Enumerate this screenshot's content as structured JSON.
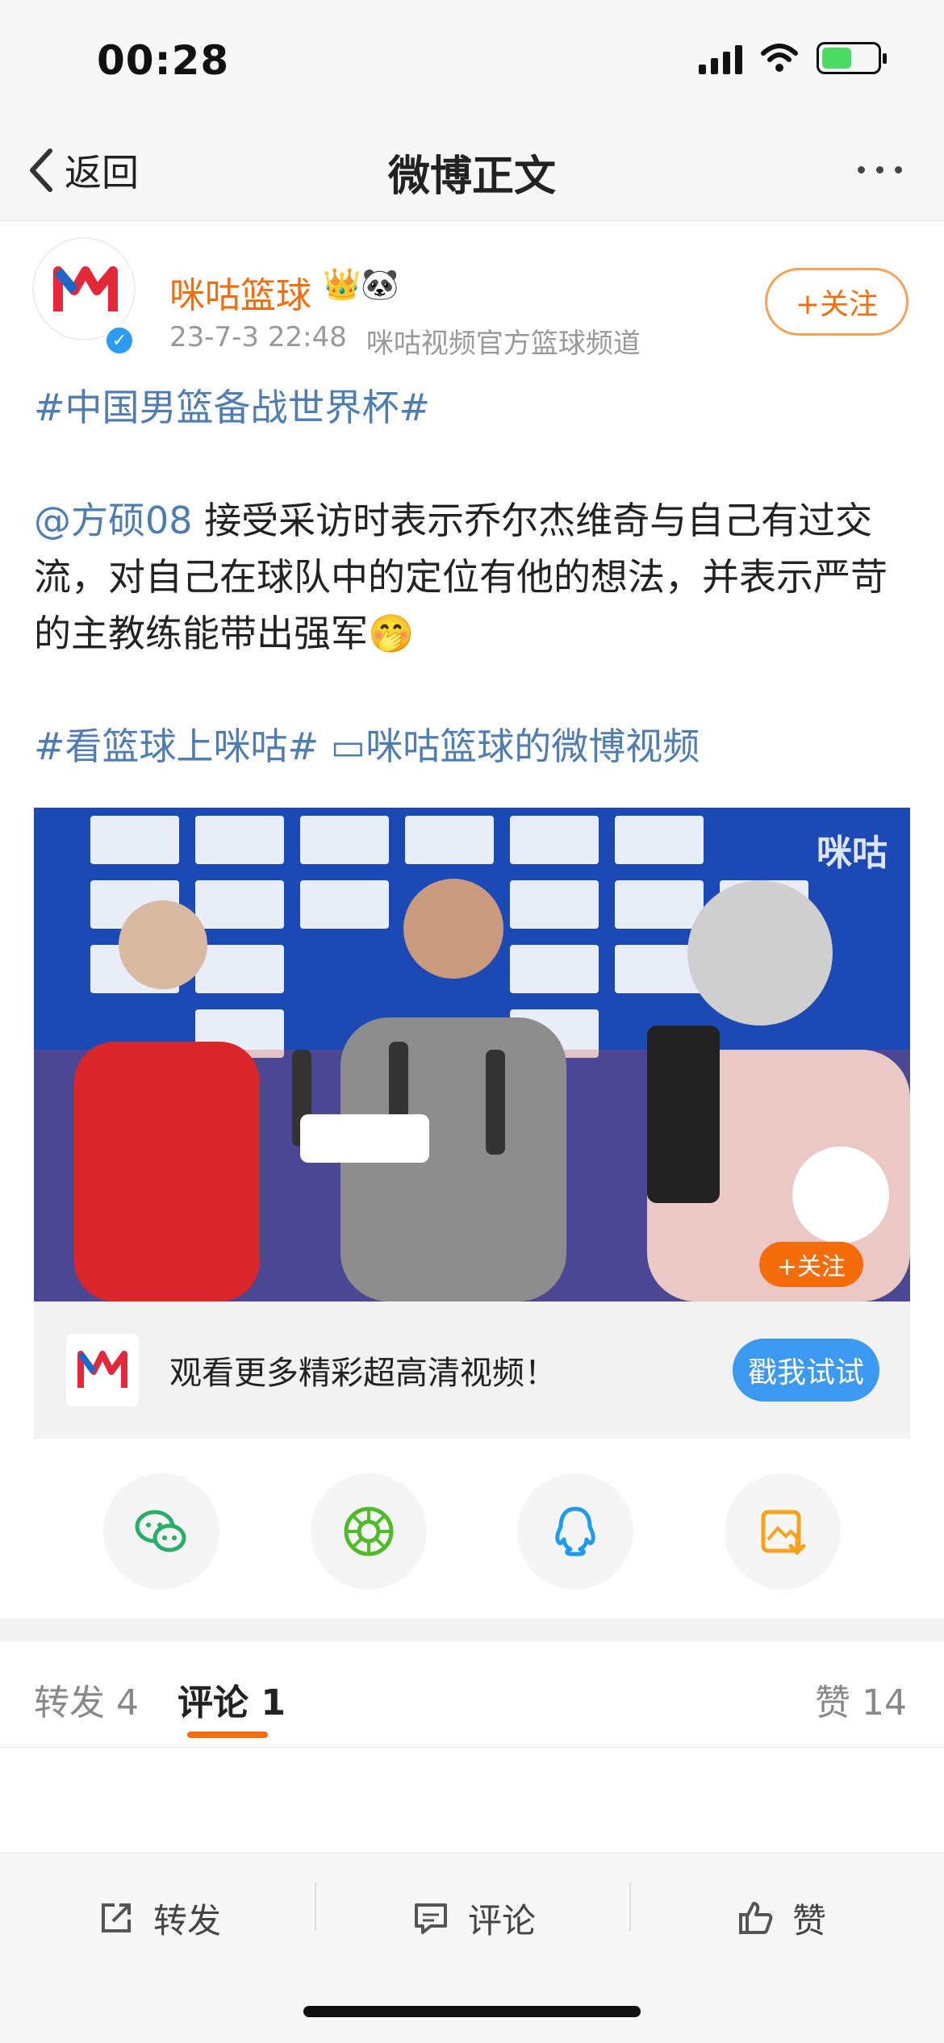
{
  "status_bar": {
    "time": "00:28"
  },
  "nav": {
    "back_label": "返回",
    "title": "微博正文"
  },
  "post": {
    "author": "咪咕篮球",
    "author_badges": "👑🐼",
    "date": "23-7-3 22:48",
    "source": "咪咕视频官方篮球频道",
    "follow_label": "+关注",
    "hashtag1": "#中国男篮备战世界杯#",
    "mention": "@方硕08",
    "text_body": " 接受采访时表示乔尔杰维奇与自己有过交流，对自己在球队中的定位有他的想法，并表示严苛的主教练能带出强军",
    "emoji": "🤭",
    "hashtag2": "#看篮球上咪咕#",
    "video_link": "咪咕篮球的微博视频"
  },
  "video": {
    "watermark": "咪咕",
    "follow_label": "+关注",
    "promo_text": "观看更多精彩超高清视频！",
    "promo_button": "戳我试试"
  },
  "share": {
    "items": [
      {
        "icon": "wechat-icon",
        "color": "#2aae67"
      },
      {
        "icon": "moments-icon",
        "color": "#4fbb2b"
      },
      {
        "icon": "qq-icon",
        "color": "#1d9bf0"
      },
      {
        "icon": "save-image-icon",
        "color": "#f7a21b"
      }
    ]
  },
  "tabs": {
    "repost": "转发 4",
    "comment": "评论 1",
    "like": "赞 14"
  },
  "actions": {
    "repost": "转发",
    "comment": "评论",
    "like": "赞"
  },
  "colors": {
    "brand_orange": "#f56c0c",
    "link_blue": "#507daf",
    "promo_blue": "#3d98f0"
  }
}
